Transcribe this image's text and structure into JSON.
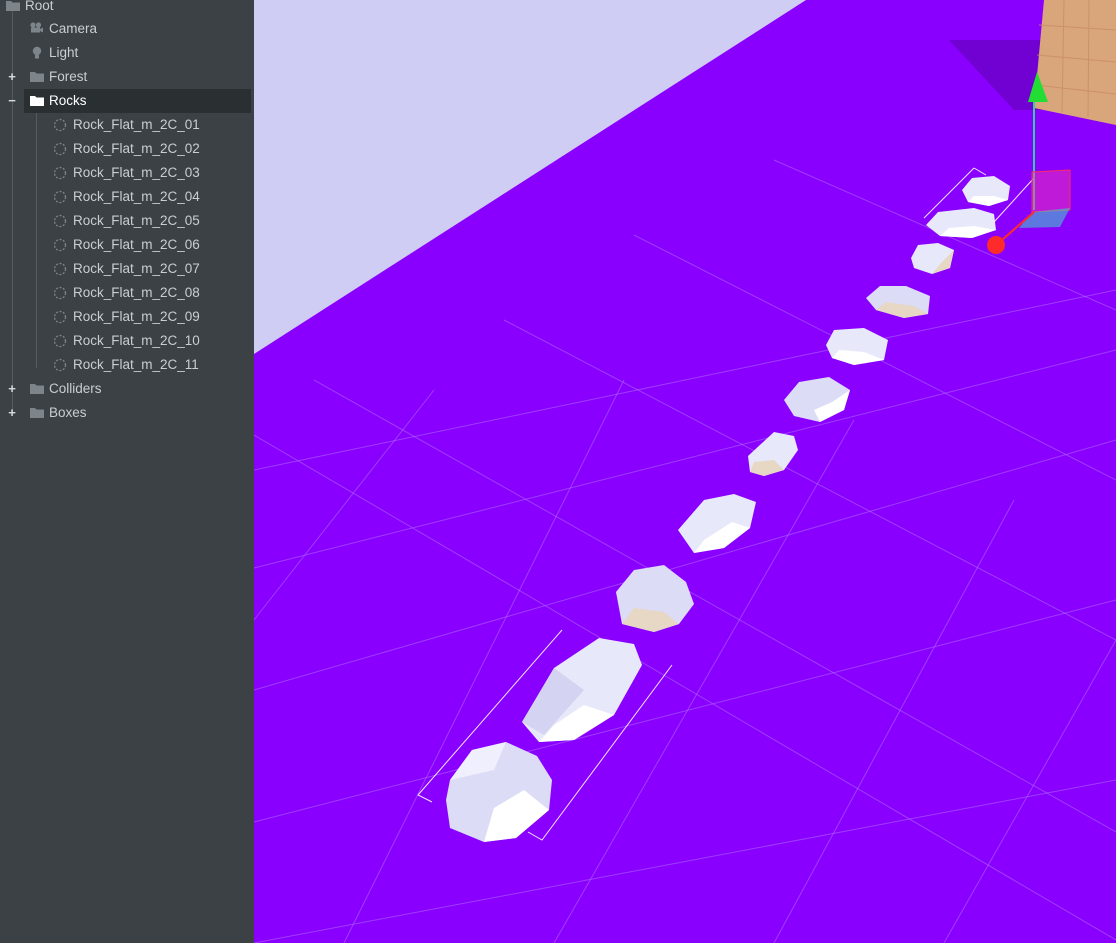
{
  "hierarchy": {
    "root": "Root",
    "items": [
      {
        "label": "Camera",
        "icon": "camera-icon"
      },
      {
        "label": "Light",
        "icon": "light-icon"
      },
      {
        "label": "Forest",
        "icon": "folder-icon",
        "toggle": "+"
      },
      {
        "label": "Rocks",
        "icon": "folder-icon",
        "toggle": "−",
        "selected": true
      },
      {
        "label": "Rock_Flat_m_2C_01",
        "icon": "mesh-icon"
      },
      {
        "label": "Rock_Flat_m_2C_02",
        "icon": "mesh-icon"
      },
      {
        "label": "Rock_Flat_m_2C_03",
        "icon": "mesh-icon"
      },
      {
        "label": "Rock_Flat_m_2C_04",
        "icon": "mesh-icon"
      },
      {
        "label": "Rock_Flat_m_2C_05",
        "icon": "mesh-icon"
      },
      {
        "label": "Rock_Flat_m_2C_06",
        "icon": "mesh-icon"
      },
      {
        "label": "Rock_Flat_m_2C_07",
        "icon": "mesh-icon"
      },
      {
        "label": "Rock_Flat_m_2C_08",
        "icon": "mesh-icon"
      },
      {
        "label": "Rock_Flat_m_2C_09",
        "icon": "mesh-icon"
      },
      {
        "label": "Rock_Flat_m_2C_10",
        "icon": "mesh-icon"
      },
      {
        "label": "Rock_Flat_m_2C_11",
        "icon": "mesh-icon"
      },
      {
        "label": "Colliders",
        "icon": "folder-icon",
        "toggle": "+"
      },
      {
        "label": "Boxes",
        "icon": "folder-icon",
        "toggle": "+"
      }
    ]
  },
  "viewport": {
    "ground_color": "#8a00ff",
    "sky_color": "#cfcdf3",
    "rock_color": "#e8e8fb",
    "gizmo": {
      "y_axis_color": "#22dd33",
      "x_axis_color": "#ff2a2a",
      "plane_color": "#ff3aa8"
    }
  }
}
